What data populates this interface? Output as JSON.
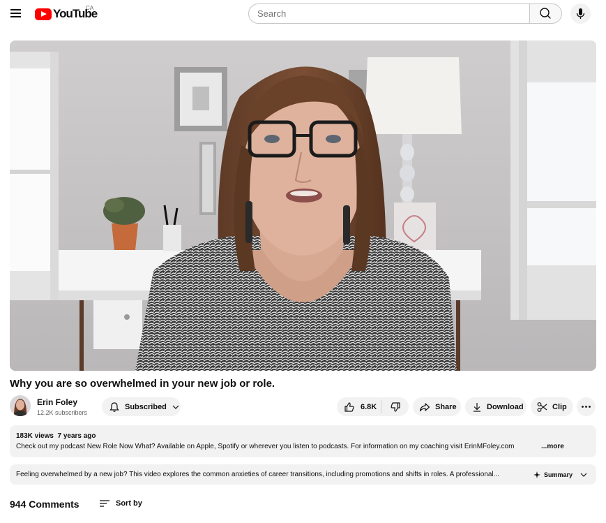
{
  "header": {
    "logo_text": "YouTube",
    "country_code": "CA",
    "search_placeholder": "Search",
    "icons": {
      "menu": "hamburger-menu-icon",
      "search": "search-icon",
      "voice": "microphone-icon"
    }
  },
  "video": {
    "title": "Why you are so overwhelmed in your new job or role."
  },
  "channel": {
    "name": "Erin Foley",
    "subscribers": "12.2K subscribers",
    "subscribe_label": "Subscribed"
  },
  "actions": {
    "likes": "6.8K",
    "share_label": "Share",
    "download_label": "Download",
    "clip_label": "Clip"
  },
  "description": {
    "meta": "183K views  7 years ago",
    "text": "Check out my podcast New Role Now What? Available on Apple, Spotify or wherever you listen to podcasts.  For information on my coaching visit ErinMFoley.com",
    "more_label": "...more"
  },
  "summary": {
    "text": "Feeling overwhelmed by a new job? This video explores the common anxieties of career transitions, including promotions and shifts in roles. A professional...",
    "button_label": "Summary"
  },
  "comments": {
    "count_label": "944 Comments",
    "sort_label": "Sort by"
  },
  "colors": {
    "brand_red": "#ff0000",
    "chip_bg": "#f2f2f2",
    "text_primary": "#0f0f0f",
    "text_secondary": "#606060"
  }
}
